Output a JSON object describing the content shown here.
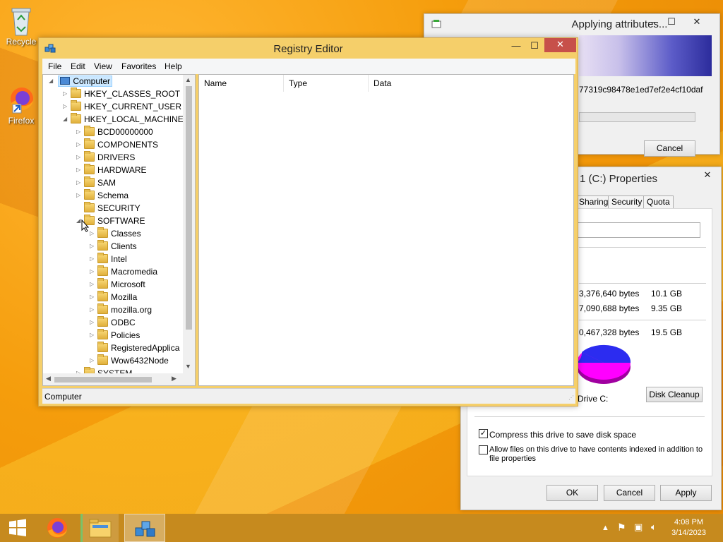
{
  "desktop": {
    "recycle_label": "Recycle",
    "firefox_label": "Firefox"
  },
  "apply_dialog": {
    "title": "Applying attributes...",
    "hash_text": "77319c98478e1ed7ef2e4cf10daf",
    "cancel_label": "Cancel",
    "minimize_glyph": "—",
    "maximize_glyph": "☐",
    "close_glyph": "✕"
  },
  "props_dialog": {
    "title": "1 (C:) Properties",
    "close_glyph": "✕",
    "tabs": [
      "Sharing",
      "Security",
      "Quota"
    ],
    "used_bytes": "3,376,640 bytes",
    "used_gb": "10.1 GB",
    "free_bytes": "7,090,688 bytes",
    "free_gb": "9.35 GB",
    "capacity_bytes": "0,467,328 bytes",
    "capacity_gb": "19.5 GB",
    "drive_label": "Drive C:",
    "disk_cleanup_label": "Disk Cleanup",
    "compress_label": "Compress this drive to save disk space",
    "compress_checked": true,
    "index_label_1": "Allow files on this drive to have contents indexed in addition to",
    "index_label_2": "file properties",
    "index_checked": false,
    "ok_label": "OK",
    "cancel_label": "Cancel",
    "apply_label": "Apply",
    "colors": {
      "used": "#2c2cf0",
      "free": "#ff00ff"
    }
  },
  "regedit": {
    "title": "Registry Editor",
    "minimize_glyph": "—",
    "maximize_glyph": "☐",
    "close_glyph": "✕",
    "menu": [
      "File",
      "Edit",
      "View",
      "Favorites",
      "Help"
    ],
    "columns": [
      "Name",
      "Type",
      "Data"
    ],
    "status": "Computer",
    "tree": {
      "root": "Computer",
      "hives": [
        "HKEY_CLASSES_ROOT",
        "HKEY_CURRENT_USER",
        "HKEY_LOCAL_MACHINE"
      ],
      "hklm_children": [
        "BCD00000000",
        "COMPONENTS",
        "DRIVERS",
        "HARDWARE",
        "SAM",
        "Schema",
        "SECURITY",
        "SOFTWARE"
      ],
      "software_children": [
        "Classes",
        "Clients",
        "Intel",
        "Macromedia",
        "Microsoft",
        "Mozilla",
        "mozilla.org",
        "ODBC",
        "Policies",
        "RegisteredApplica",
        "Wow6432Node"
      ],
      "next_partial": "SYSTEM"
    }
  },
  "taskbar": {
    "time": "4:08 PM",
    "date": "3/14/2023"
  }
}
